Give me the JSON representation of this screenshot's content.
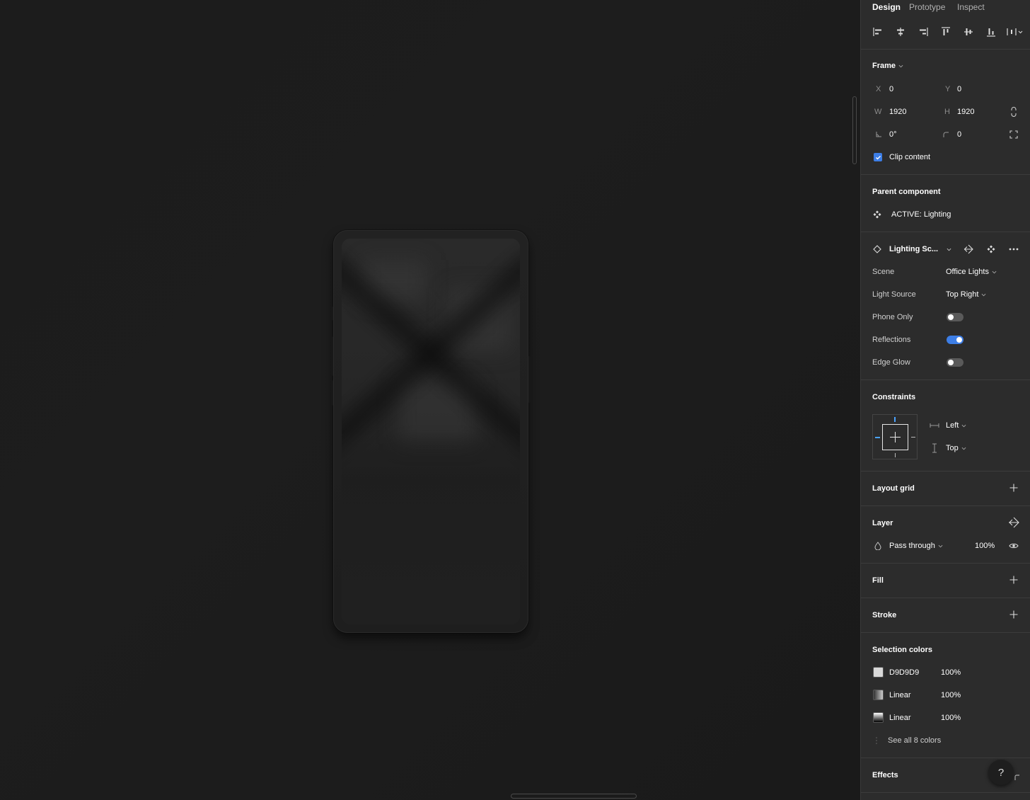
{
  "tabs": [
    "Design",
    "Prototype",
    "Inspect"
  ],
  "frame": {
    "title": "Frame",
    "x_label": "X",
    "x_value": "0",
    "y_label": "Y",
    "y_value": "0",
    "w_label": "W",
    "w_value": "1920",
    "h_label": "H",
    "h_value": "1920",
    "rotation_value": "0°",
    "radius_value": "0",
    "clip_content_label": "Clip content"
  },
  "parent_component": {
    "title": "Parent component",
    "name": "ACTIVE: Lighting"
  },
  "instance": {
    "name": "Lighting Sc...",
    "properties": [
      {
        "label": "Scene",
        "value": "Office Lights"
      },
      {
        "label": "Light Source",
        "value": "Top Right"
      }
    ],
    "toggles": [
      {
        "label": "Phone Only",
        "on": false
      },
      {
        "label": "Reflections",
        "on": true
      },
      {
        "label": "Edge Glow",
        "on": false
      }
    ]
  },
  "constraints": {
    "title": "Constraints",
    "horizontal": "Left",
    "vertical": "Top"
  },
  "layout_grid": {
    "title": "Layout grid"
  },
  "layer": {
    "title": "Layer",
    "blend_mode": "Pass through",
    "opacity": "100%"
  },
  "fill": {
    "title": "Fill"
  },
  "stroke": {
    "title": "Stroke"
  },
  "selection_colors": {
    "title": "Selection colors",
    "items": [
      {
        "name": "D9D9D9",
        "opacity": "100%",
        "swatch": "#d9d9d9"
      },
      {
        "name": "Linear",
        "opacity": "100%",
        "swatch": "linear-gray"
      },
      {
        "name": "Linear",
        "opacity": "100%",
        "swatch": "linear-black"
      }
    ],
    "see_all_label": "See all 8 colors"
  },
  "effects": {
    "title": "Effects"
  },
  "help": {
    "label": "?"
  },
  "colors": {
    "accent": "#3d7ee6",
    "panel_bg": "#2c2c2c",
    "canvas_bg": "#1c1c1c"
  }
}
